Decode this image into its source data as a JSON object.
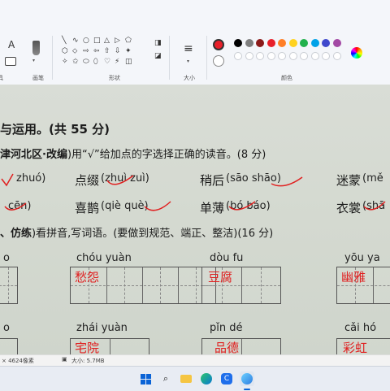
{
  "ribbon": {
    "groups": [
      {
        "label": "画笔"
      },
      {
        "label": "形状"
      },
      {
        "label": "大小"
      },
      {
        "label": "颜色"
      }
    ],
    "tool_glyph": "A",
    "size_glyph": "≡",
    "shape_glyphs": [
      "╲",
      "∿",
      "○",
      "□",
      "△",
      "▷",
      "⬠",
      "⬡",
      "⬦",
      "⇨",
      "⇦",
      "⇧",
      "⇩",
      "✦",
      "✧",
      "✩",
      "⬭",
      "⬯",
      "♡",
      "⚡",
      "◫",
      "◨"
    ],
    "active_color": "#e8202a",
    "secondary_color": "#ffffff",
    "palette_top": [
      "#000000",
      "#7f7f7f",
      "#8b1a1a",
      "#e8202a",
      "#ff7f27",
      "#ffd21f",
      "#22b14c",
      "#00a2e8",
      "#3f48cc",
      "#a349a4"
    ],
    "palette_bottom_empty": 10
  },
  "document": {
    "section_title": "与运用。(共 55 分)",
    "q1_source": "津河北区·改编",
    "q1_text": ")用“√”给加点的字选择正确的读音。(8 分)",
    "row1": {
      "a": "zhuó)",
      "b_word": "点缀",
      "b_opts": "(zhuì  zuì)",
      "c_word": "稍后",
      "c_opts": "(sāo  shāo)",
      "d_word": "迷蒙",
      "d_opts": "(mě"
    },
    "row2": {
      "a": "cēn)",
      "b_word": "喜鹊",
      "b_opts": "(qiè  què)",
      "c_word": "单薄",
      "c_opts": "(bó  báo)",
      "d_word": "衣裳",
      "d_opts": "(shā"
    },
    "q2_source": "、仿练",
    "q2_text": ")看拼音,写词语。(要做到规范、端正、整洁)(16 分)",
    "pinyin_row1": [
      "o",
      "chóu  yuàn",
      "dòu     fu",
      "yōu      ya"
    ],
    "answers_row1": [
      "愁怨",
      "豆腐",
      "幽雅"
    ],
    "pinyin_row2": [
      "o",
      "zhái  yuàn",
      "pǐn     dé",
      "cǎi     hó"
    ],
    "answers_row2": [
      "宅院",
      "品德",
      "彩虹"
    ]
  },
  "statusbar": {
    "dimensions": "× 4624像素",
    "filesize": "大小: 5.7MB"
  },
  "taskbar": {
    "apps": [
      "windows-start",
      "search",
      "file-explorer",
      "edge",
      "clipchamp",
      "browser",
      "paint"
    ]
  }
}
